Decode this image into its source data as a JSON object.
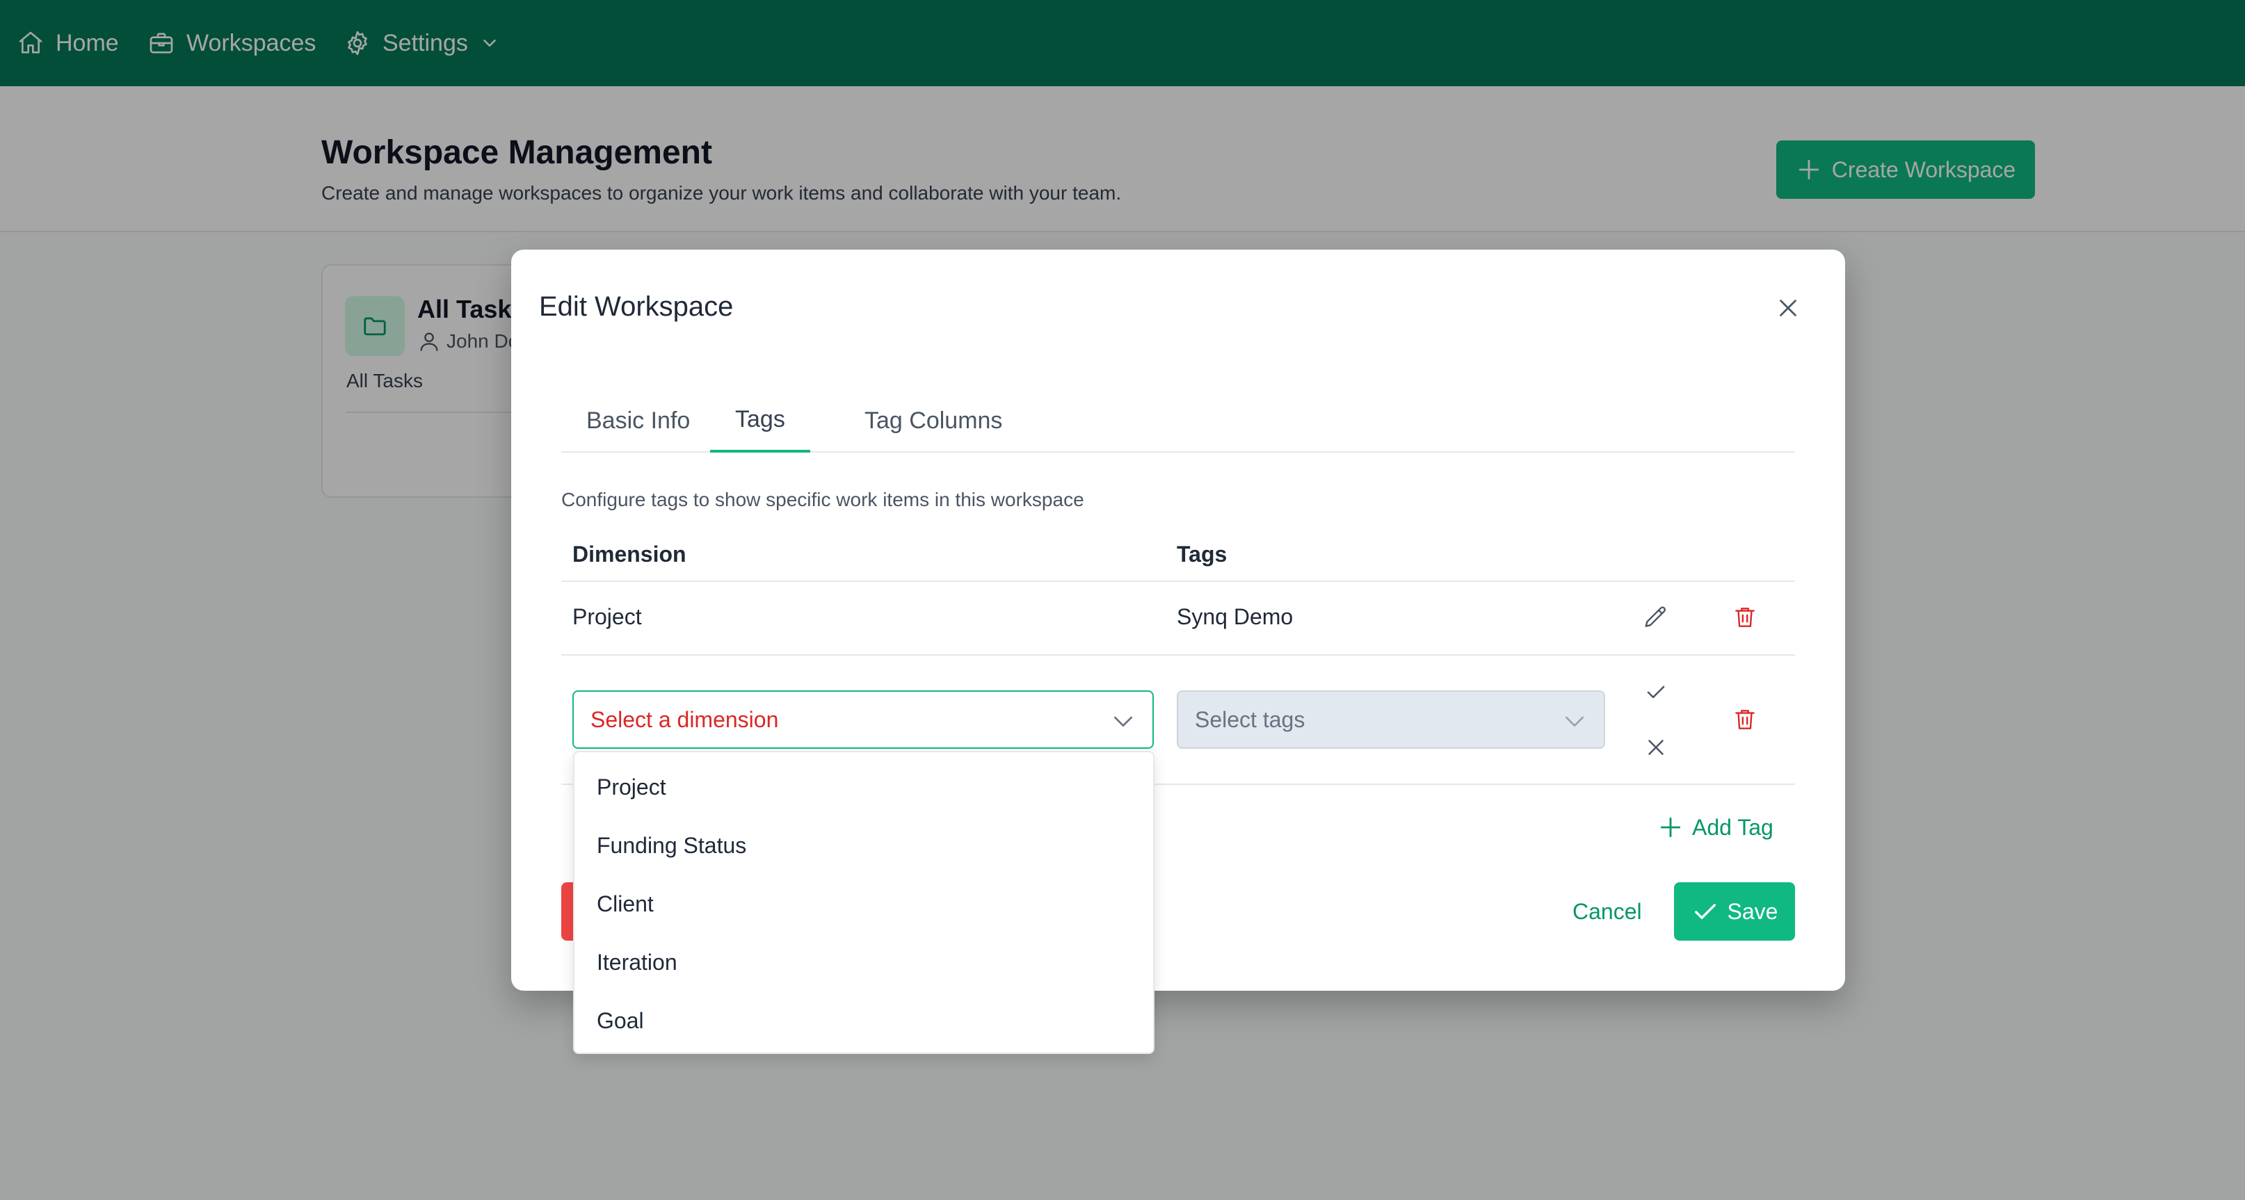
{
  "nav": {
    "home": "Home",
    "workspaces": "Workspaces",
    "settings": "Settings"
  },
  "header": {
    "title": "Workspace Management",
    "subtitle": "Create and manage workspaces to organize your work items and collaborate with your team.",
    "create_button": "Create Workspace"
  },
  "workspace_card": {
    "title": "All Tasks",
    "owner": "John Do",
    "description": "All Tasks"
  },
  "modal": {
    "title": "Edit Workspace",
    "tabs": [
      {
        "label": "Basic Info",
        "active": false
      },
      {
        "label": "Tags",
        "active": true
      },
      {
        "label": "Tag Columns",
        "active": false
      }
    ],
    "description": "Configure tags to show specific work items in this workspace",
    "columns": {
      "dimension": "Dimension",
      "tags": "Tags"
    },
    "rows": [
      {
        "dimension": "Project",
        "tags": "Synq Demo"
      }
    ],
    "new_row": {
      "dimension_placeholder": "Select a dimension",
      "tags_placeholder": "Select tags"
    },
    "add_tag": "Add Tag",
    "cancel": "Cancel",
    "save": "Save"
  },
  "dropdown": {
    "options": [
      "Project",
      "Funding Status",
      "Client",
      "Iteration",
      "Goal"
    ]
  },
  "colors": {
    "nav_bg": "#047857",
    "accent": "#10b981",
    "danger": "#dc2626",
    "overlay": "rgba(0,0,0,0.35)"
  },
  "icons": [
    "home-icon",
    "briefcase-icon",
    "gear-icon",
    "chevron-down-icon",
    "plus-icon",
    "folder-icon",
    "user-icon",
    "close-icon",
    "pencil-icon",
    "trash-icon",
    "check-icon"
  ]
}
